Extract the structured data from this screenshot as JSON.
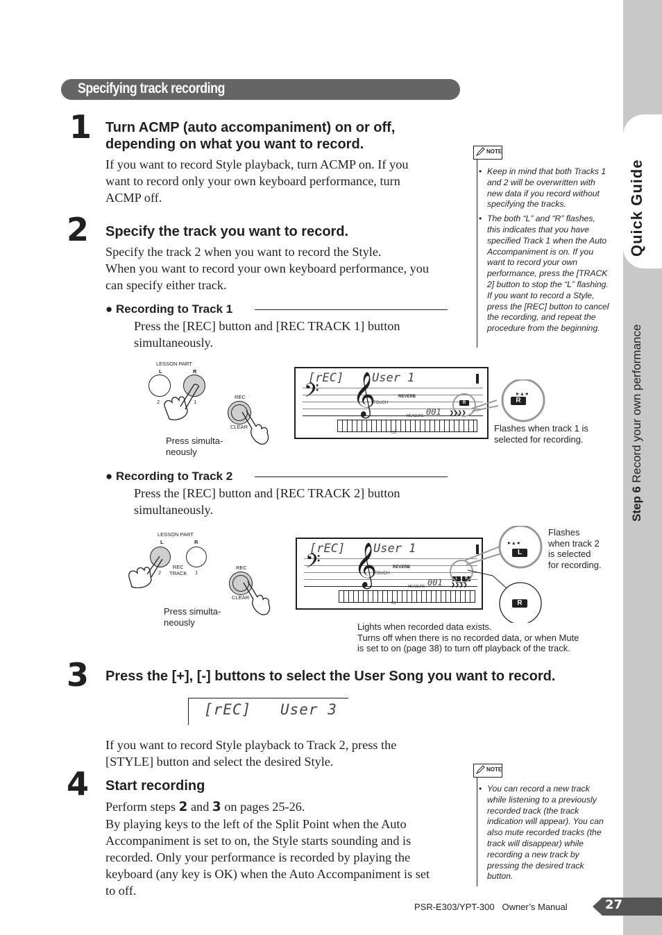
{
  "section_title": "Specifying track recording",
  "sidebar": {
    "tab_label": "Quick Guide",
    "step_label": "Step 6",
    "step_title": "Record your own performance"
  },
  "steps": [
    {
      "number": "1",
      "heading_line1": "Turn ACMP (auto accompaniment) on or off,",
      "heading_line2": "depending on what you want to record.",
      "body": [
        "If you want to record Style playback, turn ACMP on. If you",
        "want to record only your own keyboard performance, turn",
        "ACMP off."
      ]
    },
    {
      "number": "2",
      "heading": "Specify the track you want to record.",
      "body": [
        "Specify the track 2 when you want to record the Style.",
        "When you want to record your own keyboard performance, you",
        "can specify either track."
      ],
      "sub": [
        {
          "title": "Recording to Track 1",
          "body": [
            "Press the [REC] button and [REC TRACK 1] button",
            "simultaneously."
          ]
        },
        {
          "title": "Recording to Track 2",
          "body": [
            "Press the [REC] button and [REC TRACK 2] button",
            "simultaneously."
          ]
        }
      ]
    },
    {
      "number": "3",
      "heading": "Press the [+], [-] buttons to select the User Song you want to record.",
      "display_rec": "[rEC]",
      "display_song": "User 3",
      "body": [
        "If you want to record Style playback to Track 2, press the",
        "[STYLE] button and select the desired Style."
      ]
    },
    {
      "number": "4",
      "heading": "Start recording",
      "body_intro_a": "Perform steps",
      "body_intro_b": "2",
      "body_intro_c": "and",
      "body_intro_d": "3",
      "body_intro_e": "on pages 25-26.",
      "body": [
        "By playing keys to the left of the Split Point when the Auto",
        "Accompaniment is set to on, the Style starts sounding and is",
        "recorded. Only your performance is recorded by playing the",
        "keyboard (any key is OK) when the Auto Accompaniment is set",
        "to off."
      ]
    }
  ],
  "notes": [
    {
      "badge": "NOTE",
      "items": [
        "Keep in mind that both Tracks 1 and 2 will be overwritten with new data if you record without specifying the tracks.",
        "The both “L” and “R” flashes, this indicates that you have specified Track 1 when the Auto Accompaniment is on. If you want to record your own performance, press the [TRACK 2] button to stop the “L” flashing. If you want to record a Style, press the [REC] button to cancel the recording, and repeat the procedure from the beginning."
      ]
    },
    {
      "badge": "NOTE",
      "items": [
        "You can record a new track while listening to a previously recorded track (the track indication will appear). You can also mute recorded tracks (the track will disappear) while recording a new track by pressing the desired track button."
      ]
    }
  ],
  "figure1": {
    "lesson_part": "LESSON PART",
    "l": "L",
    "r": "R",
    "num_left": "2",
    "num_right": "1",
    "rec": "REC",
    "clear": "CLEAR",
    "press_caption": "Press simulta-\nneously",
    "lcd_rec": "[rEC]",
    "lcd_song": "User 1",
    "reverb": "REVERB",
    "touch": "TOUCH",
    "measure": "MEASURE",
    "measure_value": "001",
    "c3": "C3",
    "indicator": "R",
    "callout": "Flashes when track 1 is selected for recording."
  },
  "figure2": {
    "lesson_part": "LESSON PART",
    "l": "L",
    "r": "R",
    "num_left": "2",
    "num_right": "1",
    "rec_track": "REC\nTRACK",
    "rec": "REC",
    "clear": "CLEAR",
    "press_caption": "Press simulta-\nneously",
    "lcd_rec": "[rEC]",
    "lcd_song": "User 1",
    "reverb": "REVERB",
    "touch": "TOUCH",
    "measure": "MEASURE",
    "measure_value": "001",
    "c3": "C3",
    "indicator_l": "L",
    "indicator_r": "R",
    "callout_flash": "Flashes\nwhen track 2\nis selected\nfor recording.",
    "callout_lights": "Lights when recorded data exists.\nTurns off when there is no recorded data, or when Mute\nis set to on (page 38) to turn off playback of the track."
  },
  "footer": {
    "manual": "PSR-E303/YPT-300   Owner’s Manual",
    "page": "27"
  }
}
